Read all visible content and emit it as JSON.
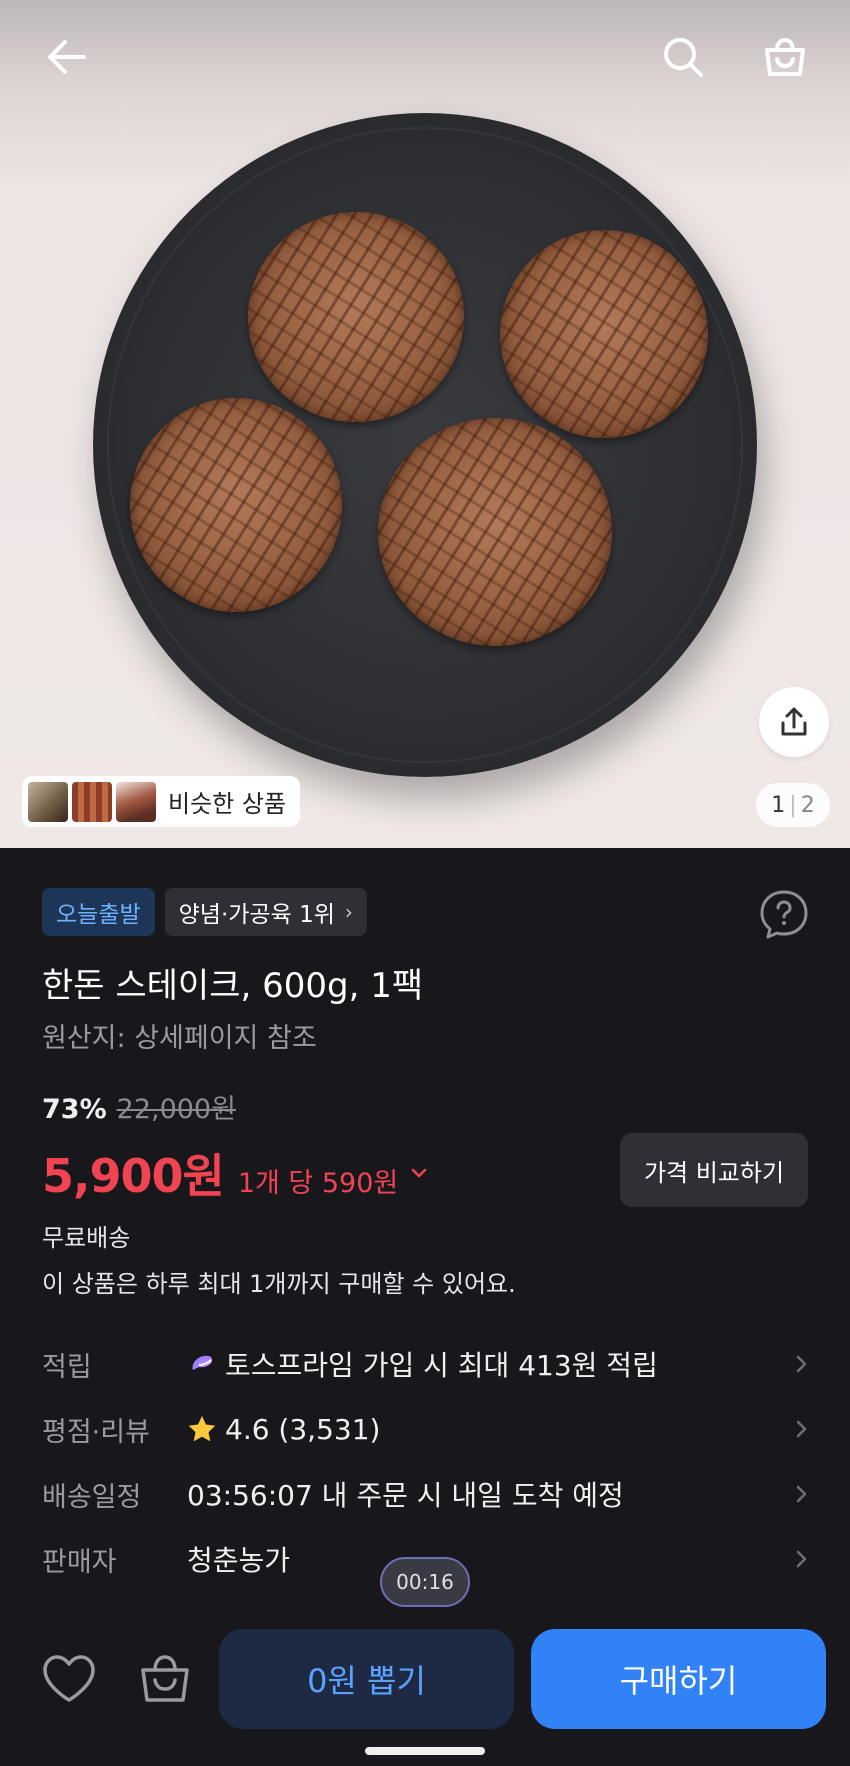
{
  "header": {
    "back_icon": "back-arrow-icon",
    "search_icon": "search-icon",
    "cart_icon": "shopping-bag-icon"
  },
  "gallery": {
    "similar_label": "비슷한 상품",
    "current_page": "1",
    "separator": "|",
    "total_pages": "2",
    "share_icon": "share-icon"
  },
  "badges": {
    "today_ship": "오늘출발",
    "rank": "양념·가공육 1위",
    "rank_chevron": "›"
  },
  "product": {
    "title": "한돈 스테이크, 600g, 1팩",
    "origin": "원산지: 상세페이지 참조",
    "discount_rate": "73%",
    "original_price": "22,000원",
    "price": "5,900원",
    "unit_price": "1개 당 590원",
    "compare_label": "가격 비교하기",
    "shipping": "무료배송",
    "purchase_limit": "이 상품은 하루 최대 1개까지 구매할 수 있어요."
  },
  "info_rows": [
    {
      "key": "적립",
      "value": "토스프라임 가입 시 최대 413원 적립",
      "icon": "toss-prime-icon"
    },
    {
      "key": "평점·리뷰",
      "value": "4.6 (3,531)",
      "icon": "star-icon"
    },
    {
      "key": "배송일정",
      "value": "03:56:07 내 주문 시 내일 도착 예정"
    },
    {
      "key": "판매자",
      "value": "청춘농가"
    }
  ],
  "timer": "00:16",
  "bottom_bar": {
    "zero_won_label": "0원 뽑기",
    "buy_label": "구매하기"
  },
  "colors": {
    "background": "#17171c",
    "price_red": "#f04452",
    "primary_blue": "#3182f6",
    "today_badge_bg": "#1d3557",
    "today_badge_text": "#6fb1ff"
  }
}
